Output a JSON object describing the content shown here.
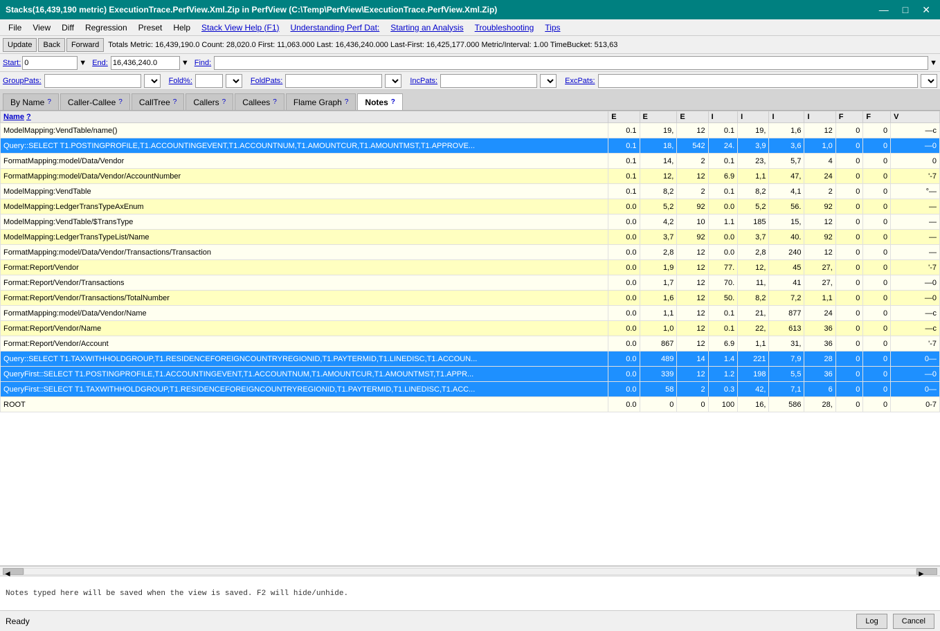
{
  "titleBar": {
    "title": "Stacks(16,439,190 metric) ExecutionTrace.PerfView.Xml.Zip in PerfView (C:\\Temp\\PerfView\\ExecutionTrace.PerfView.Xml.Zip)",
    "minimize": "—",
    "maximize": "□",
    "close": "✕"
  },
  "menuBar": {
    "items": [
      "File",
      "View",
      "Diff",
      "Regression",
      "Preset",
      "Help"
    ],
    "links": [
      "Stack View Help (F1)",
      "Understanding Perf Dat:",
      "Starting an Analysis",
      "Troubleshooting",
      "Tips"
    ]
  },
  "toolbar": {
    "update": "Update",
    "back": "Back",
    "forward": "Forward",
    "metricInfo": "Totals Metric: 16,439,190.0  Count: 28,020.0  First: 11,063.000  Last: 16,436,240.000  Last-First: 16,425,177.000  Metric/Interval: 1.00  TimeBucket: 513,63"
  },
  "startEnd": {
    "startLabel": "Start:",
    "startValue": "0",
    "endLabel": "End:",
    "endValue": "16,436,240.0",
    "findLabel": "Find:"
  },
  "pats": {
    "groupPats": "GroupPats:",
    "foldPct": "Fold%:",
    "foldPats": "FoldPats:",
    "incPats": "IncPats:",
    "excPats": "ExcPats:"
  },
  "tabs": [
    {
      "label": "By Name",
      "help": "?",
      "active": false
    },
    {
      "label": "Caller-Callee",
      "help": "?",
      "active": false
    },
    {
      "label": "CallTree",
      "help": "?",
      "active": false
    },
    {
      "label": "Callers",
      "help": "?",
      "active": false
    },
    {
      "label": "Callees",
      "help": "?",
      "active": false
    },
    {
      "label": "Flame Graph",
      "help": "?",
      "active": false
    },
    {
      "label": "Notes",
      "help": "?",
      "active": true
    }
  ],
  "table": {
    "columns": [
      {
        "key": "name",
        "label": "Name",
        "helpLink": "?"
      },
      {
        "key": "e1",
        "label": "E"
      },
      {
        "key": "e2",
        "label": "E"
      },
      {
        "key": "e3",
        "label": "E"
      },
      {
        "key": "i1",
        "label": "I"
      },
      {
        "key": "i2",
        "label": "I"
      },
      {
        "key": "i3",
        "label": "I"
      },
      {
        "key": "i4",
        "label": "I"
      },
      {
        "key": "f1",
        "label": "F"
      },
      {
        "key": "f2",
        "label": "F"
      },
      {
        "key": "v",
        "label": "V"
      }
    ],
    "rows": [
      {
        "name": "ModelMapping:VendTable/name()",
        "e1": "0.1",
        "e2": "19,",
        "e3": "12",
        "i1": "0.1",
        "i2": "19,",
        "i3": "1,6",
        "i4": "12",
        "f1": "0",
        "f2": "0",
        "v": "—c",
        "style": "normal"
      },
      {
        "name": "Query::SELECT T1.POSTINGPROFILE,T1.ACCOUNTINGEVENT,T1.ACCOUNTNUM,T1.AMOUNTCUR,T1.AMOUNTMST,T1.APPROVE...",
        "e1": "0.1",
        "e2": "18,",
        "e3": "542",
        "i1": "24.",
        "i2": "3,9",
        "i3": "3,6",
        "i4": "1,0",
        "f1": "0",
        "f2": "0",
        "v": "—0",
        "style": "highlight"
      },
      {
        "name": "FormatMapping:model/Data/Vendor",
        "e1": "0.1",
        "e2": "14,",
        "e3": "2",
        "i1": "0.1",
        "i2": "23,",
        "i3": "5,7",
        "i4": "4",
        "f1": "0",
        "f2": "0",
        "v": "0",
        "style": "normal"
      },
      {
        "name": "FormatMapping:model/Data/Vendor/AccountNumber",
        "e1": "0.1",
        "e2": "12,",
        "e3": "12",
        "i1": "6.9",
        "i2": "1,1",
        "i3": "47,",
        "i4": "24",
        "f1": "0",
        "f2": "0",
        "v": "'-7",
        "style": "yellow"
      },
      {
        "name": "ModelMapping:VendTable",
        "e1": "0.1",
        "e2": "8,2",
        "e3": "2",
        "i1": "0.1",
        "i2": "8,2",
        "i3": "4,1",
        "i4": "2",
        "f1": "0",
        "f2": "0",
        "v": "°—",
        "style": "normal"
      },
      {
        "name": "ModelMapping:LedgerTransTypeAxEnum",
        "e1": "0.0",
        "e2": "5,2",
        "e3": "92",
        "i1": "0.0",
        "i2": "5,2",
        "i3": "56.",
        "i4": "92",
        "f1": "0",
        "f2": "0",
        "v": "—",
        "style": "yellow"
      },
      {
        "name": "ModelMapping:VendTable/$TransType",
        "e1": "0.0",
        "e2": "4,2",
        "e3": "10",
        "i1": "1.1",
        "i2": "185",
        "i3": "15,",
        "i4": "12",
        "f1": "0",
        "f2": "0",
        "v": "—",
        "style": "normal"
      },
      {
        "name": "ModelMapping:LedgerTransTypeList/Name",
        "e1": "0.0",
        "e2": "3,7",
        "e3": "92",
        "i1": "0.0",
        "i2": "3,7",
        "i3": "40.",
        "i4": "92",
        "f1": "0",
        "f2": "0",
        "v": "—",
        "style": "yellow"
      },
      {
        "name": "FormatMapping:model/Data/Vendor/Transactions/Transaction",
        "e1": "0.0",
        "e2": "2,8",
        "e3": "12",
        "i1": "0.0",
        "i2": "2,8",
        "i3": "240",
        "i4": "12",
        "f1": "0",
        "f2": "0",
        "v": "—",
        "style": "normal"
      },
      {
        "name": "Format:Report/Vendor",
        "e1": "0.0",
        "e2": "1,9",
        "e3": "12",
        "i1": "77.",
        "i2": "12,",
        "i3": "45",
        "i4": "27,",
        "f1": "0",
        "f2": "0",
        "v": "'-7",
        "style": "yellow"
      },
      {
        "name": "Format:Report/Vendor/Transactions",
        "e1": "0.0",
        "e2": "1,7",
        "e3": "12",
        "i1": "70.",
        "i2": "11,",
        "i3": "41",
        "i4": "27,",
        "f1": "0",
        "f2": "0",
        "v": "—0",
        "style": "normal"
      },
      {
        "name": "Format:Report/Vendor/Transactions/TotalNumber",
        "e1": "0.0",
        "e2": "1,6",
        "e3": "12",
        "i1": "50.",
        "i2": "8,2",
        "i3": "7,2",
        "i4": "1,1",
        "f1": "0",
        "f2": "0",
        "v": "—0",
        "style": "yellow"
      },
      {
        "name": "FormatMapping:model/Data/Vendor/Name",
        "e1": "0.0",
        "e2": "1,1",
        "e3": "12",
        "i1": "0.1",
        "i2": "21,",
        "i3": "877",
        "i4": "24",
        "f1": "0",
        "f2": "0",
        "v": "—c",
        "style": "normal"
      },
      {
        "name": "Format:Report/Vendor/Name",
        "e1": "0.0",
        "e2": "1,0",
        "e3": "12",
        "i1": "0.1",
        "i2": "22,",
        "i3": "613",
        "i4": "36",
        "f1": "0",
        "f2": "0",
        "v": "—c",
        "style": "yellow"
      },
      {
        "name": "Format:Report/Vendor/Account",
        "e1": "0.0",
        "e2": "867",
        "e3": "12",
        "i1": "6.9",
        "i2": "1,1",
        "i3": "31,",
        "i4": "36",
        "f1": "0",
        "f2": "0",
        "v": "'-7",
        "style": "normal"
      },
      {
        "name": "Query::SELECT T1.TAXWITHHOLDGROUP,T1.RESIDENCEFOREIGNCOUNTRYREGIONID,T1.PAYTERMID,T1.LINEDISC,T1.ACCOUN...",
        "e1": "0.0",
        "e2": "489",
        "e3": "14",
        "i1": "1.4",
        "i2": "221",
        "i3": "7,9",
        "i4": "28",
        "f1": "0",
        "f2": "0",
        "v": "0—",
        "style": "highlight"
      },
      {
        "name": "QueryFirst::SELECT T1.POSTINGPROFILE,T1.ACCOUNTINGEVENT,T1.ACCOUNTNUM,T1.AMOUNTCUR,T1.AMOUNTMST,T1.APPR...",
        "e1": "0.0",
        "e2": "339",
        "e3": "12",
        "i1": "1.2",
        "i2": "198",
        "i3": "5,5",
        "i4": "36",
        "f1": "0",
        "f2": "0",
        "v": "—0",
        "style": "highlight"
      },
      {
        "name": "QueryFirst::SELECT T1.TAXWITHHOLDGROUP,T1.RESIDENCEFOREIGNCOUNTRYREGIONID,T1.PAYTERMID,T1.LINEDISC,T1.ACC...",
        "e1": "0.0",
        "e2": "58",
        "e3": "2",
        "i1": "0.3",
        "i2": "42,",
        "i3": "7,1",
        "i4": "6",
        "f1": "0",
        "f2": "0",
        "v": "0—",
        "style": "highlight"
      },
      {
        "name": "ROOT",
        "e1": "0.0",
        "e2": "0",
        "e3": "0",
        "i1": "100",
        "i2": "16,",
        "i3": "586",
        "i4": "28,",
        "f1": "0",
        "f2": "0",
        "v": "0-7",
        "style": "normal"
      }
    ]
  },
  "notesBar": {
    "text": "Notes typed here will be saved when the view is saved.  F2 will hide/unhide."
  },
  "statusBar": {
    "status": "Ready",
    "logButton": "Log",
    "cancelButton": "Cancel"
  }
}
